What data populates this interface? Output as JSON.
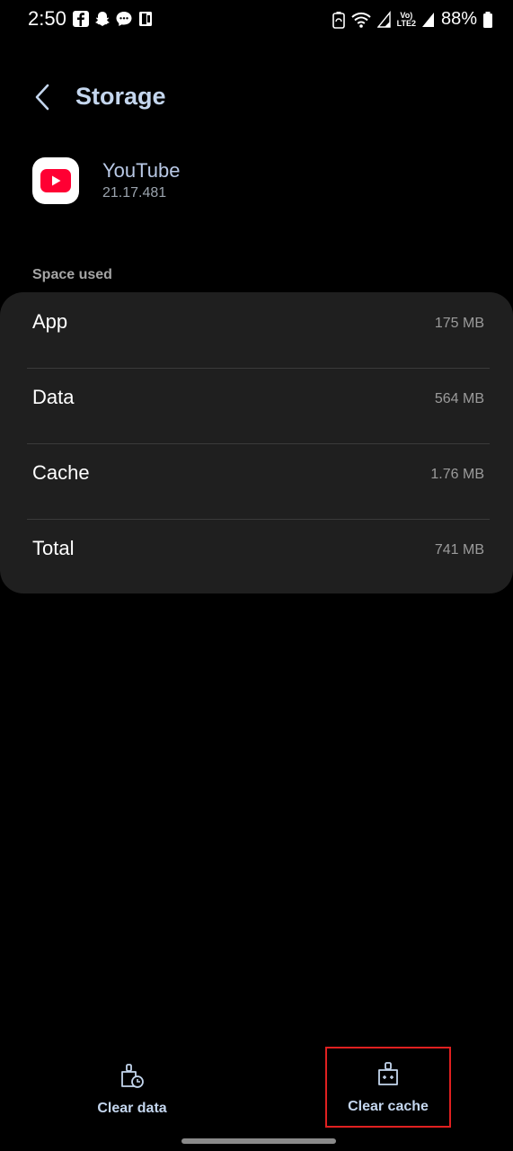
{
  "status_bar": {
    "time": "2:50",
    "battery": "88%",
    "notification_icons": [
      "facebook-icon",
      "snapchat-icon",
      "messenger-icon",
      "phone-icon"
    ],
    "system_icons": [
      "battery-saver-icon",
      "wifi-icon",
      "signal-icon",
      "volte-lte2-icon",
      "signal-icon-2",
      "battery-icon"
    ],
    "volte_label": "Vo)",
    "lte_label": "LTE2"
  },
  "header": {
    "title": "Storage"
  },
  "app": {
    "name": "YouTube",
    "version": "21.17.481",
    "icon": "youtube-icon"
  },
  "section_label": "Space used",
  "storage_rows": [
    {
      "label": "App",
      "value": "175 MB"
    },
    {
      "label": "Data",
      "value": "564 MB"
    },
    {
      "label": "Cache",
      "value": "1.76 MB"
    },
    {
      "label": "Total",
      "value": "741 MB"
    }
  ],
  "actions": {
    "clear_data": "Clear data",
    "clear_cache": "Clear cache"
  },
  "colors": {
    "background": "#000000",
    "card": "#1f1f1f",
    "accent_text": "#c4d6ee",
    "highlight_border": "#e02020",
    "youtube_red": "#ff0033"
  }
}
